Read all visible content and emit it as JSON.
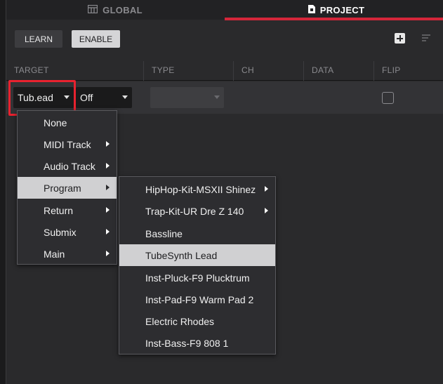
{
  "tabs": {
    "global": "GLOBAL",
    "project": "PROJECT"
  },
  "toolbar": {
    "learn": "LEARN",
    "enable": "ENABLE"
  },
  "columns": [
    "TARGET",
    "TYPE",
    "CH",
    "DATA",
    "FLIP"
  ],
  "row": {
    "target_value": "Tub.ead",
    "off_value": "Off",
    "type_value": "",
    "flip_checked": false
  },
  "menu_main": [
    {
      "label": "None",
      "has_submenu": false
    },
    {
      "label": "MIDI Track",
      "has_submenu": true
    },
    {
      "label": "Audio Track",
      "has_submenu": true
    },
    {
      "label": "Program",
      "has_submenu": true,
      "active": true
    },
    {
      "label": "Return",
      "has_submenu": true
    },
    {
      "label": "Submix",
      "has_submenu": true
    },
    {
      "label": "Main",
      "has_submenu": true
    }
  ],
  "menu_program": [
    {
      "label": "HipHop-Kit-MSXII Shinez",
      "has_submenu": true
    },
    {
      "label": "Trap-Kit-UR Dre Z 140",
      "has_submenu": true
    },
    {
      "label": "Bassline",
      "has_submenu": false
    },
    {
      "label": "TubeSynth Lead",
      "has_submenu": false,
      "active": true
    },
    {
      "label": "Inst-Pluck-F9 Plucktrum",
      "has_submenu": false
    },
    {
      "label": "Inst-Pad-F9 Warm Pad 2",
      "has_submenu": false
    },
    {
      "label": "Electric Rhodes",
      "has_submenu": false
    },
    {
      "label": "Inst-Bass-F9 808 1",
      "has_submenu": false
    }
  ],
  "colors": {
    "accent": "#d5263a",
    "highlight_box": "#e8222f"
  }
}
